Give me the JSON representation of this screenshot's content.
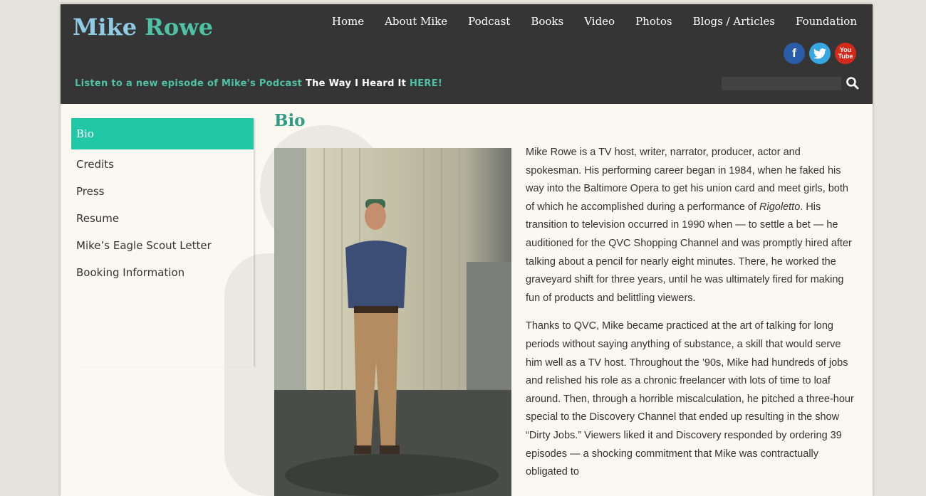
{
  "site": {
    "logo_first": "Mike",
    "logo_last": "Rowe"
  },
  "nav": [
    {
      "label": "Home"
    },
    {
      "label": "About Mike"
    },
    {
      "label": "Podcast"
    },
    {
      "label": "Books"
    },
    {
      "label": "Video"
    },
    {
      "label": "Photos"
    },
    {
      "label": "Blogs / Articles"
    },
    {
      "label": "Foundation"
    }
  ],
  "social": {
    "facebook_glyph": "f",
    "twitter_glyph": "t",
    "youtube_glyph_top": "You",
    "youtube_glyph_bottom": "Tube"
  },
  "promo": {
    "lead": "Listen to a new episode of Mike's Podcast",
    "title": "The Way I Heard It",
    "link": "HERE!"
  },
  "search": {
    "placeholder": ""
  },
  "sidebar": {
    "items": [
      {
        "label": "Bio"
      },
      {
        "label": "Credits"
      },
      {
        "label": "Press"
      },
      {
        "label": "Resume"
      },
      {
        "label": "Mike’s Eagle Scout Letter"
      },
      {
        "label": "Booking Information"
      }
    ]
  },
  "main": {
    "title": "Bio",
    "p1_a": "Mike Rowe is a TV host, writer, narrator, producer, actor and spokesman. His performing career began in 1984, when he faked his way into the Baltimore Opera to get his union card and meet girls, both of which he accomplished during a performance of ",
    "p1_italic": "Rigoletto",
    "p1_b": ". His transition to television occurred in 1990 when — to settle a bet — he auditioned for the QVC Shopping Channel and was promptly hired after talking about a pencil for nearly eight minutes. There, he worked the graveyard shift for three years, until he was ultimately fired for making fun of products and belittling viewers.",
    "p2": "Thanks to QVC, Mike became practiced at the art of talking for long periods without saying anything of substance, a skill that would serve him well as a TV host. Throughout the ’90s, Mike had hundreds of jobs and relished his role as a chronic freelancer with lots of time to loaf around. Then, through a horrible miscalculation, he pitched a three-hour special to the Discovery Channel that ended up resulting in the show “Dirty Jobs.” Viewers liked it and Discovery responded by ordering 39 episodes — a shocking commitment that Mike was contractually obligated to"
  },
  "colors": {
    "header_bg": "#353535",
    "accent_teal": "#20c8a6",
    "logo_blue": "#8fcbe4",
    "logo_green": "#4ec2a5",
    "page_bg": "#fbf7f1"
  }
}
